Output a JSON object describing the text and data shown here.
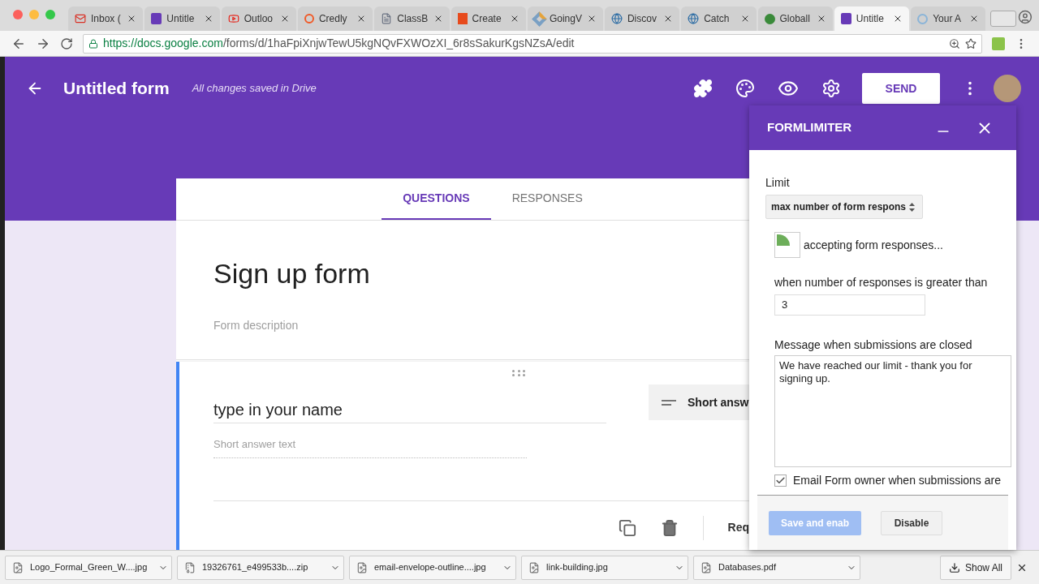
{
  "browser": {
    "tabs": [
      {
        "title": "Inbox (",
        "selected": false
      },
      {
        "title": "Untitle",
        "selected": false
      },
      {
        "title": "Outloo",
        "selected": false
      },
      {
        "title": "Credly",
        "selected": false
      },
      {
        "title": "ClassB",
        "selected": false
      },
      {
        "title": "Create",
        "selected": false
      },
      {
        "title": "GoingV",
        "selected": false
      },
      {
        "title": "Discov",
        "selected": false
      },
      {
        "title": "Catch",
        "selected": false
      },
      {
        "title": "Globall",
        "selected": false
      },
      {
        "title": "Untitle",
        "selected": true
      },
      {
        "title": "Your A",
        "selected": false
      }
    ],
    "url_host": "https://docs.google.com",
    "url_path": "/forms/d/1haFpiXnjwTewU5kgNQvFXWOzXI_6r8sSakurKgsNZsA/edit"
  },
  "header": {
    "title": "Untitled form",
    "status": "All changes saved in Drive",
    "send": "SEND"
  },
  "form_tabs": [
    {
      "label": "QUESTIONS",
      "selected": true
    },
    {
      "label": "RESPONSES",
      "selected": false
    }
  ],
  "form": {
    "title": "Sign up form",
    "description": "Form description"
  },
  "question": {
    "title": "type in your name",
    "type": "Short answ",
    "answer_placeholder": "Short answer text",
    "required": "Req"
  },
  "panel": {
    "title": "FORMLIMITER",
    "limit_label": "Limit",
    "limit_value": "max number of form respons",
    "status": "accepting form responses...",
    "threshold_label": "when number of responses is greater than",
    "threshold_value": "3",
    "message_label": "Message when submissions are closed",
    "message_value": "We have reached our limit - thank you for signing up.",
    "email_label": "Email Form owner when submissions are",
    "email_checked": true,
    "save": {
      "label": "Save and enab",
      "disabled": true
    },
    "disable": "Disable"
  },
  "downloads": [
    {
      "name": "Logo_Formal_Green_W....jpg",
      "kind": "image"
    },
    {
      "name": "19326761_e499533b....zip",
      "kind": "zip"
    },
    {
      "name": "email-envelope-outline....jpg",
      "kind": "image"
    },
    {
      "name": "link-building.jpg",
      "kind": "image"
    },
    {
      "name": "Databases.pdf",
      "kind": "image"
    }
  ],
  "show_all": "Show All"
}
